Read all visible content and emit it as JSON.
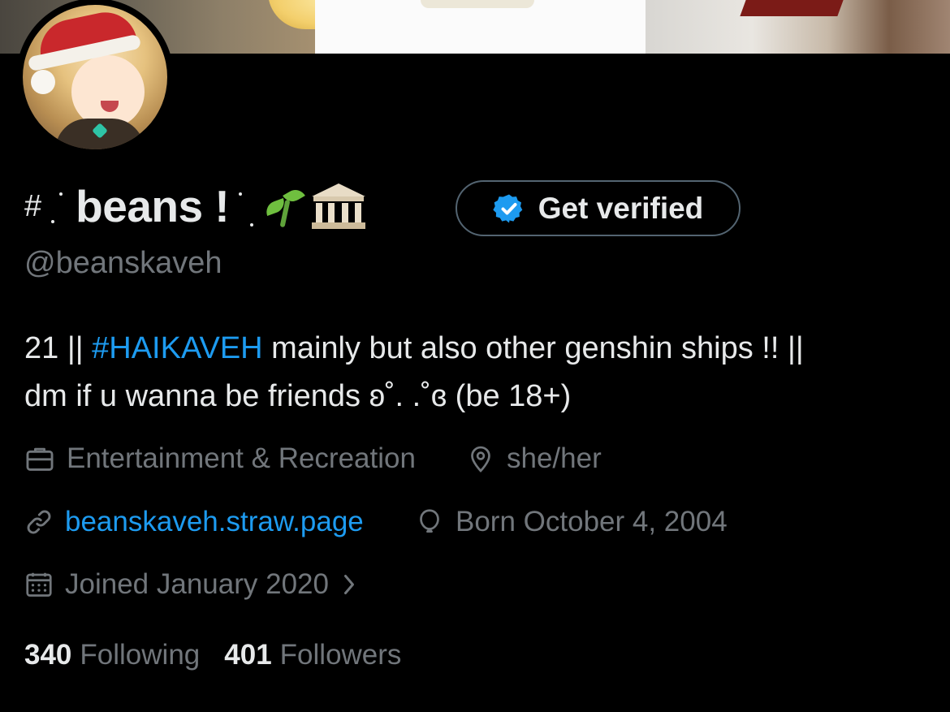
{
  "profile": {
    "name_prefix": "#",
    "name": "beans !",
    "handle": "@beanskaveh",
    "verify_label": "Get verified",
    "bio": {
      "part1": "21 || ",
      "hashtag": "#HAIKAVEH",
      "part2": " mainly but also other genshin ships !! ||",
      "line2": "dm if u wanna be friends ʚ˚. .˚ɞ (be 18+)"
    },
    "category": "Entertainment & Recreation",
    "location": "she/her",
    "website": "beanskaveh.straw.page",
    "birthday": "Born October 4, 2004",
    "joined": "Joined January 2020",
    "following_count": "340",
    "following_label": "Following",
    "followers_count": "401",
    "followers_label": "Followers"
  },
  "icons": [
    "briefcase-icon",
    "location-pin-icon",
    "link-icon",
    "balloon-icon",
    "calendar-icon",
    "chevron-right-icon",
    "verified-badge-icon",
    "sprout-emoji",
    "classical-building-emoji"
  ],
  "colors": {
    "accent": "#1d9bf0",
    "text": "#e7e9ea",
    "muted": "#71767b",
    "border": "#536471",
    "background": "#000000"
  }
}
